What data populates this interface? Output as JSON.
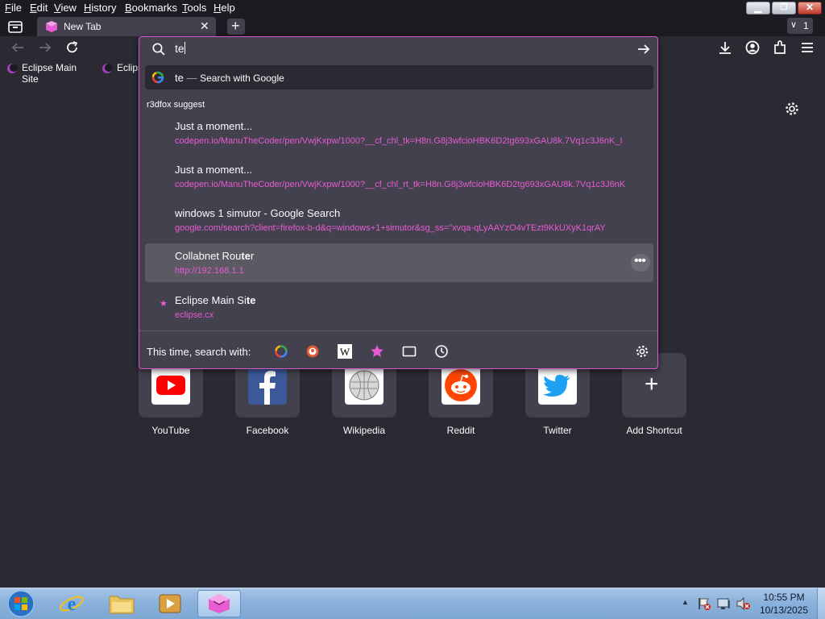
{
  "menu": [
    "File",
    "Edit",
    "View",
    "History",
    "Bookmarks",
    "Tools",
    "Help"
  ],
  "menu_underline": [
    "F",
    "E",
    "V",
    "H",
    "B",
    "T",
    "H"
  ],
  "menu_rest": [
    "ile",
    "dit",
    "iew",
    "istory",
    "ookmarks",
    "ools",
    "elp"
  ],
  "tab": {
    "title": "New Tab",
    "count": "1"
  },
  "urlbar": {
    "value": "te"
  },
  "bookmarks": [
    "Eclipse Main Site",
    "Eclips"
  ],
  "popup": {
    "heuristic": {
      "query": "te",
      "sep": "—",
      "action": "Search with Google"
    },
    "group_label": "r3dfox suggest",
    "results": [
      {
        "title": "Just a moment...",
        "url": "codepen.io/ManuTheCoder/pen/VwjKxpw/1000?__cf_chl_tk=H8n.G8j3wfcioHBK6D2tg693xGAU8k.7Vq1c3J6nK_I"
      },
      {
        "title": "Just a moment...",
        "url": "codepen.io/ManuTheCoder/pen/VwjKxpw/1000?__cf_chl_rt_tk=H8n.G8j3wfcioHBK6D2tg693xGAU8k.7Vq1c3J6nK"
      },
      {
        "title": "windows 1 simutor - Google Search",
        "url": "google.com/search?client=firefox-b-d&q=windows+1+simutor&sg_ss=\"xvqa-qLyAAYzO4vTEzt9KkUXyK1qrAY"
      },
      {
        "title_pre": "Collabnet Rou",
        "title_bold": "te",
        "title_post": "r",
        "url": "http://192.168.1.1"
      },
      {
        "title_pre": "Eclipse Main Si",
        "title_bold": "te",
        "url": "eclipse.cx"
      }
    ],
    "search_with_label": "This time, search with:"
  },
  "shortcuts": [
    "YouTube",
    "Facebook",
    "Wikipedia",
    "Reddit",
    "Twitter",
    "Add Shortcut"
  ],
  "clock": {
    "time": "10:55 PM",
    "date": "10/13/2025"
  },
  "colors": {
    "accent": "#e85bd3",
    "popup_border": "#d95ad0",
    "bg": "#2b2a33"
  }
}
